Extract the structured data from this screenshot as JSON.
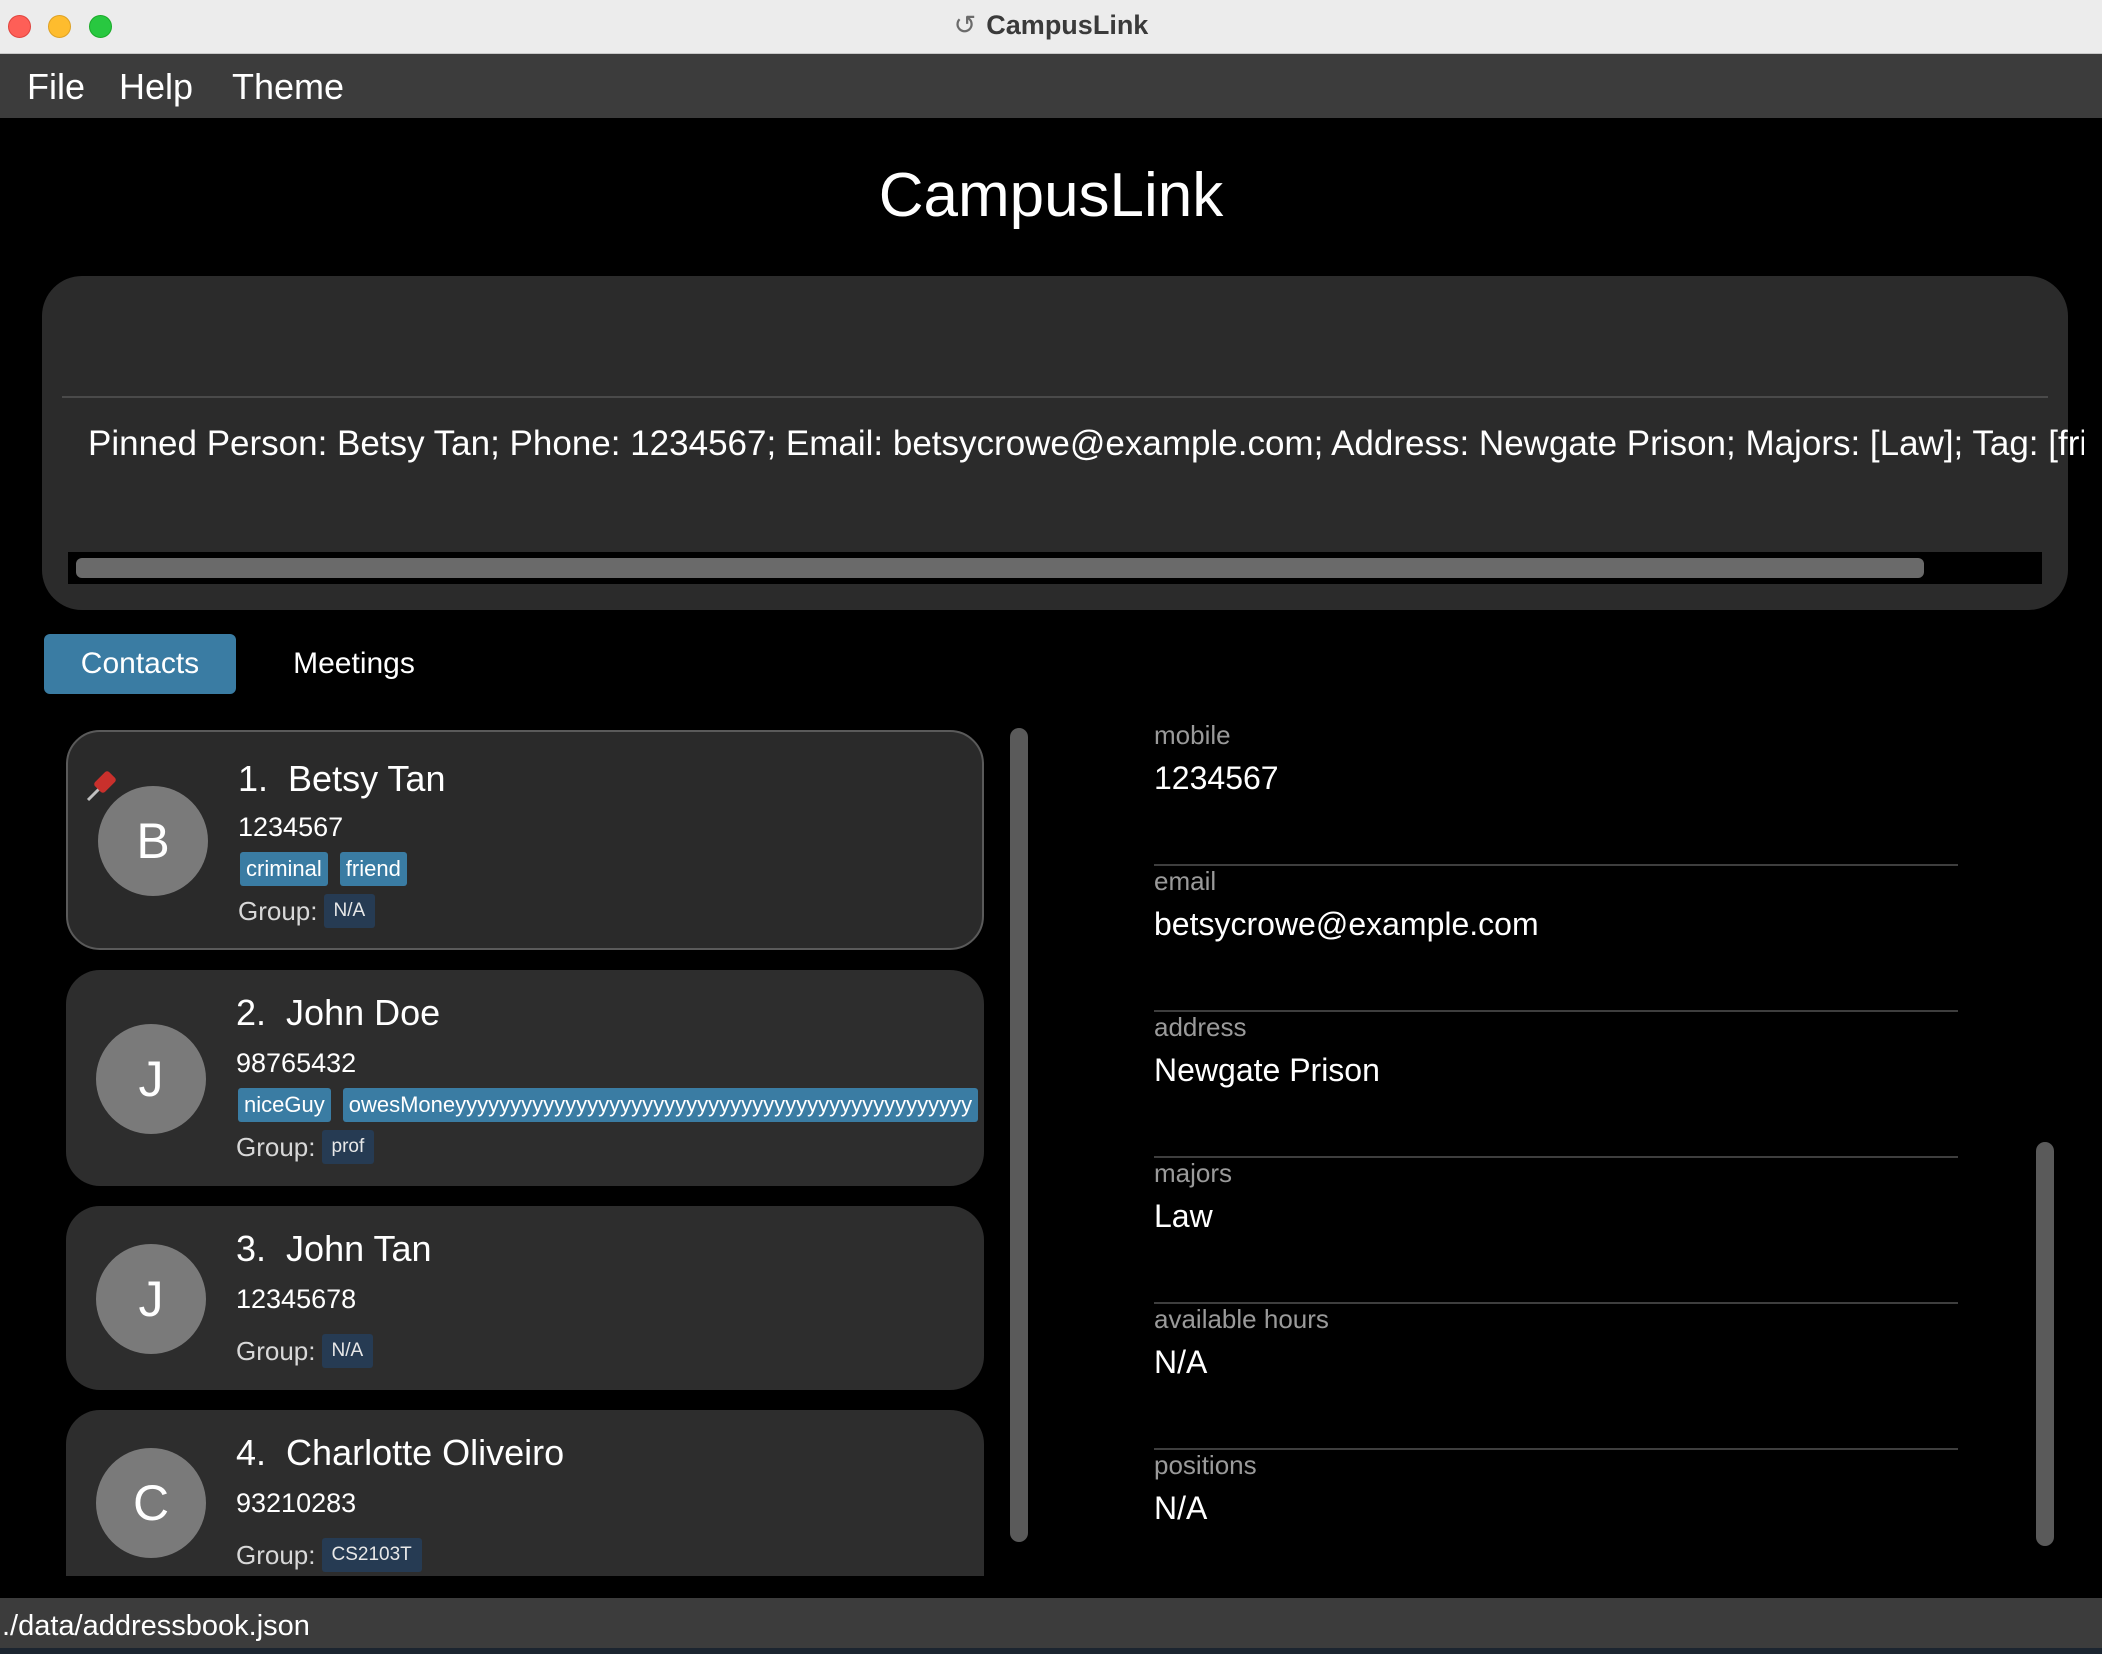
{
  "window": {
    "title": "CampusLink"
  },
  "menu": {
    "file": "File",
    "help": "Help",
    "theme": "Theme"
  },
  "app_heading": "CampusLink",
  "command": {
    "value": "",
    "placeholder": ""
  },
  "result_text": "Pinned Person: Betsy Tan; Phone: 1234567; Email: betsycrowe@example.com; Address: Newgate Prison; Majors: [Law]; Tag: [friend][criminal]",
  "tabs": {
    "contacts": "Contacts",
    "meetings": "Meetings"
  },
  "contacts": [
    {
      "index": "1.",
      "name": "Betsy Tan",
      "initial": "B",
      "phone": "1234567",
      "tags": [
        "criminal",
        "friend"
      ],
      "group_label": "Group:",
      "group": "N/A",
      "pinned": true
    },
    {
      "index": "2.",
      "name": "John Doe",
      "initial": "J",
      "phone": "98765432",
      "tags": [
        "niceGuy",
        "owesMoneyyyyyyyyyyyyyyyyyyyyyyyyyyyyyyyyyyyyyyyyyyyyyyy"
      ],
      "group_label": "Group:",
      "group": "prof",
      "pinned": false
    },
    {
      "index": "3.",
      "name": "John Tan",
      "initial": "J",
      "phone": "12345678",
      "tags": [],
      "group_label": "Group:",
      "group": "N/A",
      "pinned": false
    },
    {
      "index": "4.",
      "name": "Charlotte Oliveiro",
      "initial": "C",
      "phone": "93210283",
      "tags": [],
      "group_label": "Group:",
      "group": "CS2103T",
      "pinned": false
    }
  ],
  "details": {
    "mobile": {
      "label": "mobile",
      "value": "1234567"
    },
    "email": {
      "label": "email",
      "value": "betsycrowe@example.com"
    },
    "address": {
      "label": "address",
      "value": "Newgate Prison"
    },
    "majors": {
      "label": "majors",
      "value": "Law"
    },
    "available_hours": {
      "label": "available hours",
      "value": "N/A"
    },
    "positions": {
      "label": "positions",
      "value": "N/A"
    }
  },
  "status": {
    "path": "./data/addressbook.json"
  },
  "colors": {
    "accent": "#3a7ca3",
    "group_badge": "#263b53",
    "card_bg": "#2d2d2d"
  }
}
